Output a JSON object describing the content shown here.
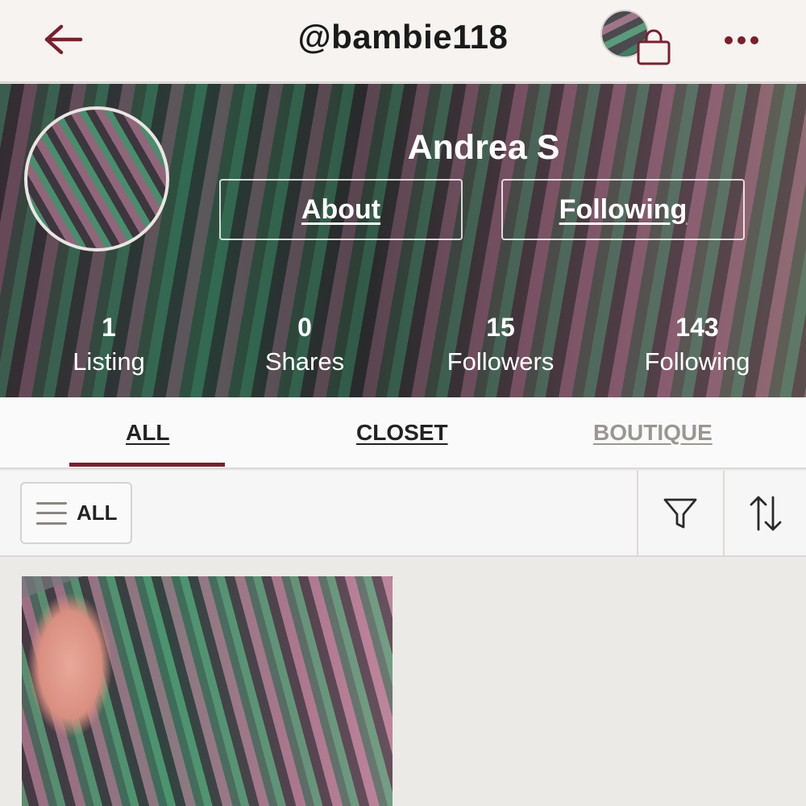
{
  "header": {
    "username": "@bambie118",
    "back_icon": "arrow-left-icon",
    "bag_icon": "shopping-bag-icon",
    "more_icon": "ellipsis-icon",
    "accent_color": "#7a1f2d"
  },
  "profile": {
    "name": "Andrea S",
    "about_label": "About",
    "following_label": "Following"
  },
  "stats": [
    {
      "value": "1",
      "label": "Listing"
    },
    {
      "value": "0",
      "label": "Shares"
    },
    {
      "value": "15",
      "label": "Followers"
    },
    {
      "value": "143",
      "label": "Following"
    }
  ],
  "tabs": [
    {
      "label": "ALL",
      "active": true
    },
    {
      "label": "CLOSET",
      "active": false
    },
    {
      "label": "BOUTIQUE",
      "active": false
    }
  ],
  "filter_bar": {
    "dropdown_label": "ALL",
    "menu_icon": "menu-lines-icon",
    "filter_icon": "funnel-icon",
    "sort_icon": "sort-arrows-icon"
  }
}
